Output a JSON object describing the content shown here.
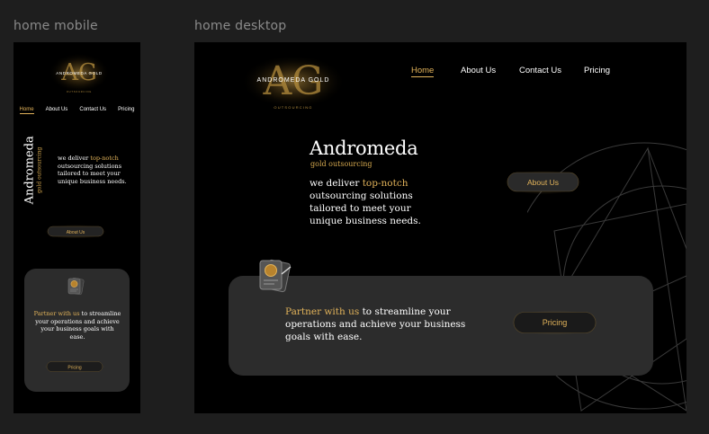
{
  "frames": {
    "mobile_label": "home mobile",
    "desktop_label": "home desktop"
  },
  "brand": {
    "logo_text": "ANDROMEDA GOLD",
    "logo_sub": "OUTSOURCING",
    "logo_initials": "AG"
  },
  "nav": {
    "items": [
      "Home",
      "About Us",
      "Contact Us",
      "Pricing"
    ],
    "active": "Home"
  },
  "hero": {
    "title": "Andromeda",
    "subtitle": "gold outsourcing",
    "desc_pre": "we deliver ",
    "desc_highlight": "top-notch",
    "desc_post": " outsourcing solutions tailored to meet your unique business needs.",
    "about_button": "About Us"
  },
  "partner": {
    "highlight": "Partner with us",
    "text": " to streamline your operations and achieve your business goals with ease.",
    "pricing_button": "Pricing"
  },
  "colors": {
    "accent": "#e2b35a",
    "background": "#000000",
    "card": "#2c2c2c",
    "canvas": "#1e1e1e"
  },
  "icons": {
    "card_icon": "documents-coin-icon",
    "geometry": "abstract-geometry-decoration"
  }
}
